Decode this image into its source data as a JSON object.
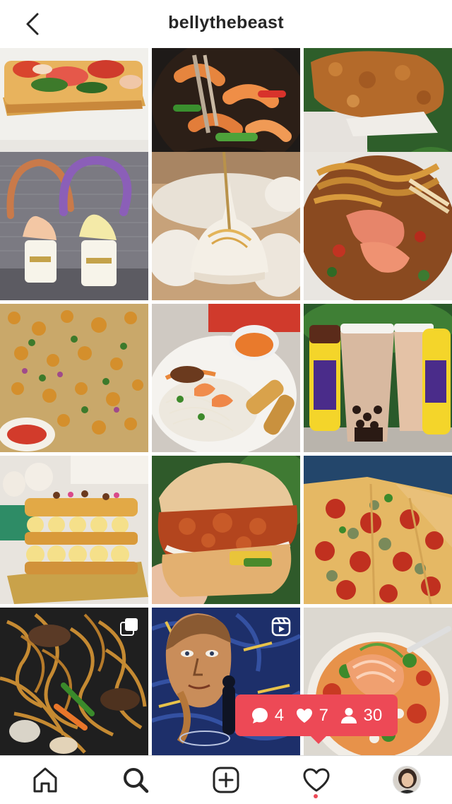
{
  "header": {
    "username": "bellythebeast",
    "back_icon": "chevron-left-icon"
  },
  "grid": {
    "posts": [
      {
        "subject": "lobster roll",
        "type": "image"
      },
      {
        "subject": "shrimp stir fry",
        "type": "image"
      },
      {
        "subject": "fried chicken",
        "type": "image"
      },
      {
        "subject": "churro soft serve",
        "type": "image"
      },
      {
        "subject": "soup dumpling",
        "type": "image"
      },
      {
        "subject": "shrimp noodles",
        "type": "image"
      },
      {
        "subject": "curry pizza",
        "type": "image"
      },
      {
        "subject": "vermicelli bowl",
        "type": "image"
      },
      {
        "subject": "boba milk tea",
        "type": "image"
      },
      {
        "subject": "napoleon pastry",
        "type": "image"
      },
      {
        "subject": "fried chicken sandwich",
        "type": "image"
      },
      {
        "subject": "pepperoni pizza",
        "type": "image"
      },
      {
        "subject": "lo mein",
        "type": "carousel"
      },
      {
        "subject": "van gogh exhibit",
        "type": "reel"
      },
      {
        "subject": "salmon poke bowl",
        "type": "image"
      }
    ]
  },
  "activity": {
    "comments": "4",
    "likes": "7",
    "follows": "30",
    "color": "#ed4956"
  },
  "tabbar": {
    "items": [
      "home-icon",
      "search-icon",
      "new-post-icon",
      "activity-heart-icon",
      "profile-avatar"
    ]
  }
}
